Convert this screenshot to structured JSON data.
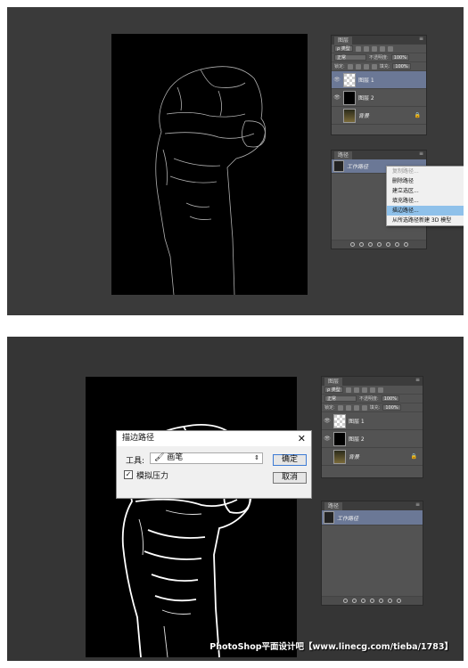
{
  "shot1": {
    "layers_panel": {
      "tab": "图层",
      "filter_label": "ρ 类型",
      "blend_mode": "正常",
      "opacity_label": "不透明度:",
      "opacity_value": "100%",
      "lock_label": "锁定:",
      "fill_label": "填充:",
      "fill_value": "100%",
      "layers": [
        {
          "name": "图层 1",
          "thumb": "checker",
          "active": true,
          "visible": true,
          "locked": false,
          "italic": false
        },
        {
          "name": "图层 2",
          "thumb": "black",
          "active": false,
          "visible": true,
          "locked": false,
          "italic": false
        },
        {
          "name": "背景",
          "thumb": "photo",
          "active": false,
          "visible": false,
          "locked": true,
          "italic": true
        }
      ]
    },
    "paths_panel": {
      "tab": "路径",
      "path_name": "工作路径"
    },
    "context_menu": [
      {
        "label": "复制路径...",
        "disabled": true,
        "highlighted": false
      },
      {
        "label": "删除路径",
        "disabled": false,
        "highlighted": false
      },
      {
        "label": "建立选区...",
        "disabled": false,
        "highlighted": false
      },
      {
        "label": "填充路径...",
        "disabled": false,
        "highlighted": false
      },
      {
        "label": "描边路径...",
        "disabled": false,
        "highlighted": true
      },
      {
        "label": "从所选路径新建 3D 模型",
        "disabled": false,
        "highlighted": false
      }
    ]
  },
  "shot2": {
    "layers_panel": {
      "tab": "图层",
      "filter_label": "ρ 类型",
      "blend_mode": "正常",
      "opacity_label": "不透明度:",
      "opacity_value": "100%",
      "lock_label": "锁定:",
      "fill_label": "填充:",
      "fill_value": "100%",
      "layers": [
        {
          "name": "图层 1",
          "thumb": "checker",
          "active": false,
          "visible": true,
          "locked": false,
          "italic": false
        },
        {
          "name": "图层 2",
          "thumb": "black",
          "active": false,
          "visible": true,
          "locked": false,
          "italic": false
        },
        {
          "name": "背景",
          "thumb": "photo",
          "active": false,
          "visible": false,
          "locked": true,
          "italic": true
        }
      ]
    },
    "paths_panel": {
      "tab": "路径",
      "path_name": "工作路径"
    },
    "dialog": {
      "title": "描边路径",
      "tool_label": "工具:",
      "tool_value": "画笔",
      "simulate_label": "模拟压力",
      "simulate_checked": "✓",
      "ok_label": "确定",
      "cancel_label": "取消"
    }
  },
  "watermark": "PhotoShop平面设计吧【www.linecg.com/tieba/1783】",
  "colors": {
    "workspace": "#3a3a3a",
    "panel": "#535353",
    "active_layer": "#6b7896",
    "menu_highlight": "#8fc1ea"
  }
}
